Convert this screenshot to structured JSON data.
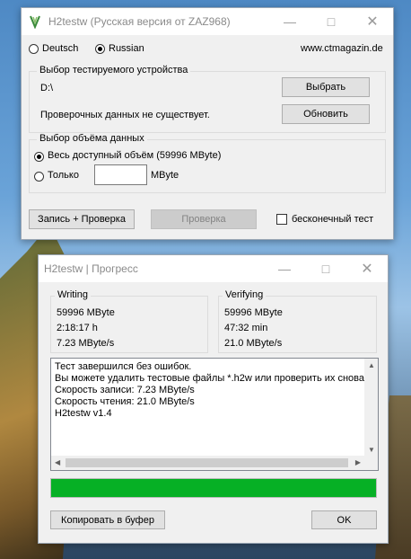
{
  "main_window": {
    "title": "H2testw (Русская версия от ZAZ968)",
    "minimize_icon": "minimize-icon",
    "maximize_icon": "maximize-icon",
    "close_icon": "close-icon",
    "lang_deutsch": "Deutsch",
    "lang_russian": "Russian",
    "lang_selected": "Russian",
    "website": "www.ctmagazin.de",
    "device_group": {
      "caption": "Выбор тестируемого устройства",
      "path": "D:\\",
      "select_button": "Выбрать",
      "status": "Проверочных данных не существует.",
      "refresh_button": "Обновить"
    },
    "volume_group": {
      "caption": "Выбор объёма данных",
      "option_all": "Весь доступный объём (59996 MByte)",
      "option_only": "Только",
      "only_value": "",
      "unit": "MByte",
      "selected": "all"
    },
    "write_verify_button": "Запись + Проверка",
    "verify_button": "Проверка",
    "endless_label": "бесконечный тест",
    "endless_checked": false
  },
  "progress_window": {
    "title": "H2testw | Прогресс",
    "writing": {
      "caption": "Writing",
      "size": "59996 MByte",
      "time": "2:18:17 h",
      "speed": "7.23 MByte/s"
    },
    "verifying": {
      "caption": "Verifying",
      "size": "59996 MByte",
      "time": "47:32 min",
      "speed": "21.0 MByte/s"
    },
    "log_lines": [
      "Тест завершился без ошибок.",
      "Вы можете удалить тестовые файлы *.h2w или проверить их снова",
      "Скорость записи: 7.23 MByte/s",
      "Скорость чтения: 21.0 MByte/s",
      "H2testw v1.4"
    ],
    "progress": 1.0,
    "progress_color": "#06b025",
    "copy_button": "Копировать в буфер",
    "ok_button": "OK"
  }
}
